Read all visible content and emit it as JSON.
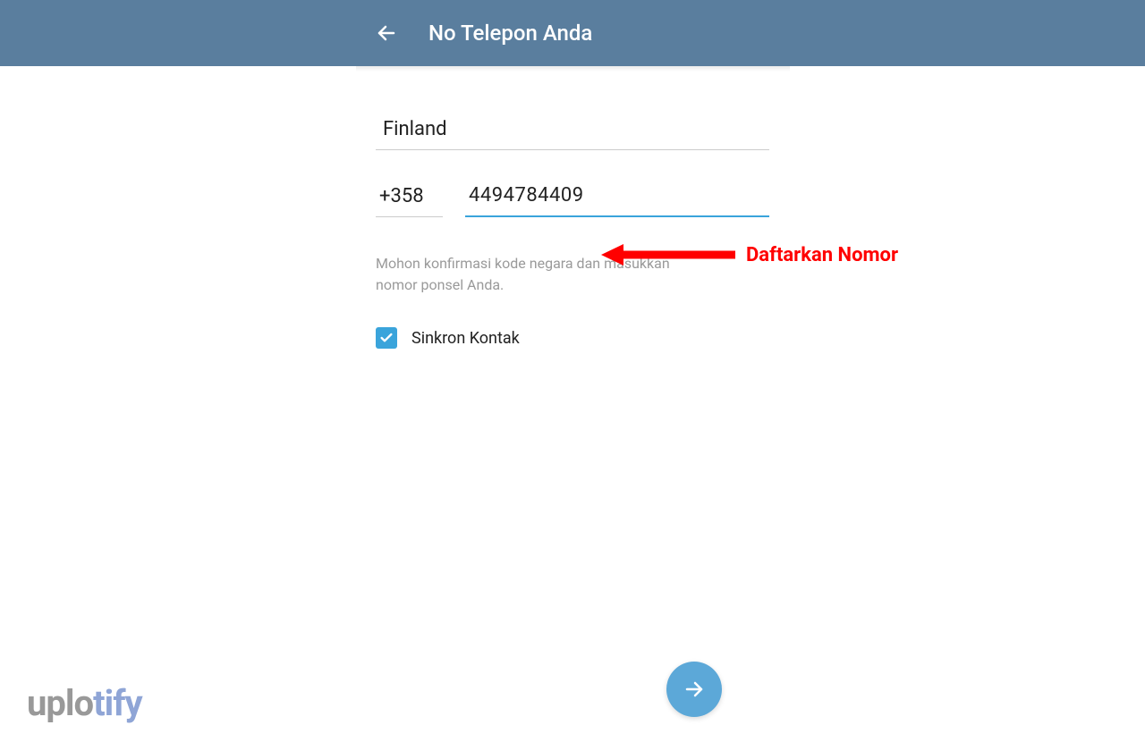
{
  "header": {
    "title": "No Telepon Anda"
  },
  "form": {
    "country": "Finland",
    "country_code": "+358",
    "phone_number": "4494784409",
    "help_text": "Mohon konfirmasi kode negara dan masukkan nomor ponsel Anda.",
    "checkbox_label": "Sinkron Kontak",
    "checkbox_checked": true
  },
  "annotation": {
    "label": "Daftarkan Nomor"
  },
  "watermark": {
    "part1": "uplo",
    "part2": "tify"
  },
  "icons": {
    "back_arrow": "←",
    "forward_arrow": "→",
    "check": "✓"
  },
  "colors": {
    "header_bg": "#5a7e9e",
    "accent": "#3aa4db",
    "fab": "#5ca8d8",
    "annotation": "#ff0000"
  }
}
